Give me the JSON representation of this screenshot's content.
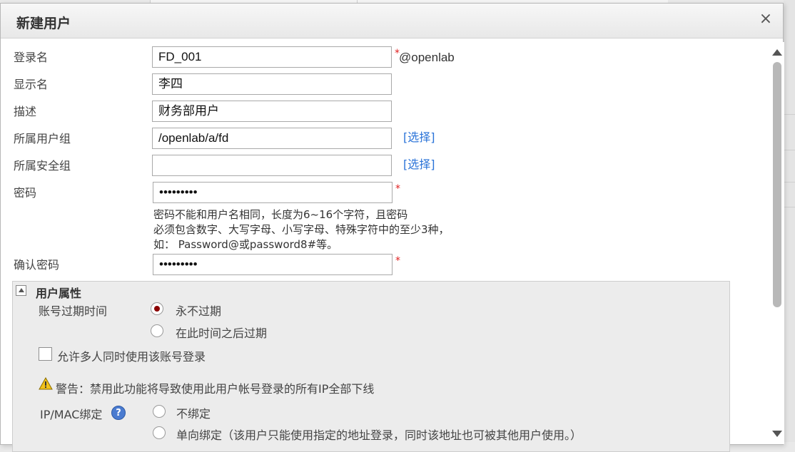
{
  "dialog": {
    "title": "新建用户",
    "close_glyph": "×"
  },
  "form": {
    "login_name": {
      "label": "登录名",
      "value": "FD_001",
      "required_mark": "*",
      "suffix": "@openlab"
    },
    "display_name": {
      "label": "显示名",
      "value": "李四"
    },
    "description": {
      "label": "描述",
      "value": "财务部用户"
    },
    "user_group": {
      "label": "所属用户组",
      "value": "/openlab/a/fd",
      "link": "[选择]"
    },
    "security_group": {
      "label": "所属安全组",
      "value": "",
      "link": "[选择]"
    },
    "password": {
      "label": "密码",
      "value": "•••••••••",
      "required_mark": "*",
      "hint_lines": [
        "密码不能和用户名相同，长度为6~16个字符，且密码",
        "必须包含数字、大写字母、小写字母、特殊字符中的至少3种，",
        "如： Password@或password8#等。"
      ]
    },
    "confirm_password": {
      "label": "确认密码",
      "value": "•••••••••",
      "required_mark": "*"
    }
  },
  "user_attributes": {
    "title": "用户属性",
    "expiry": {
      "label": "账号过期时间",
      "options": [
        {
          "label": "永不过期",
          "selected": true
        },
        {
          "label": "在此时间之后过期",
          "selected": false
        }
      ]
    },
    "allow_multi_login": {
      "label": "允许多人同时使用该账号登录",
      "checked": false
    },
    "warning": "警告：禁用此功能将导致使用此用户帐号登录的所有IP全部下线",
    "ip_mac_binding": {
      "label": "IP/MAC绑定",
      "help_glyph": "?",
      "options": [
        {
          "label": "不绑定",
          "selected": false
        },
        {
          "label": "单向绑定（该用户只能使用指定的地址登录，同时该地址也可被其他用户使用。）",
          "selected": false
        }
      ]
    }
  },
  "icons": {
    "close": "close-icon",
    "toggle": "collapse-toggle-icon",
    "warning": "warning-icon",
    "help": "help-icon",
    "scroll_up": "arrow-up-icon",
    "scroll_down": "arrow-down-icon"
  },
  "colors": {
    "link": "#2a73d8",
    "required": "#e02020",
    "radio_selected": "#8b0000",
    "help_icon": "#4a7bd0",
    "warning_icon": "#f2c21b"
  }
}
